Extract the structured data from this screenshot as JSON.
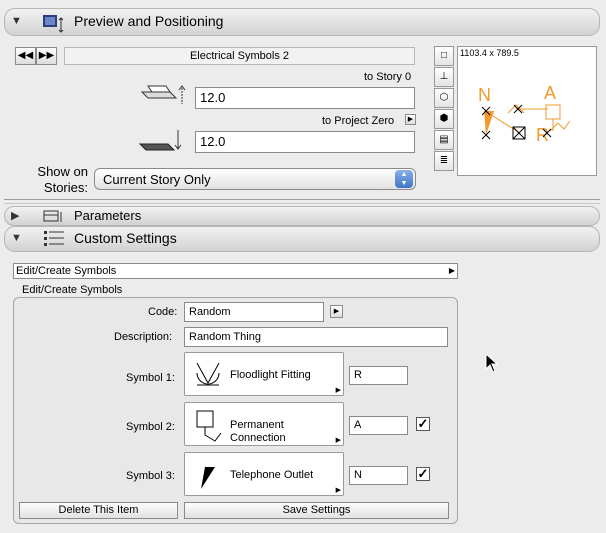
{
  "preview_section": {
    "title": "Preview and Positioning",
    "prev_label": "◀◀",
    "next_label": "▶▶",
    "symbol_name": "Electrical Symbols 2",
    "to_story_label": "to Story 0",
    "top_value": "12.0",
    "to_project_zero_label": "to Project Zero",
    "bottom_value": "12.0",
    "show_on_stories_label": "Show on\nStories:",
    "show_on_stories_value": "Current Story Only",
    "preview_size": "1103.4 x 789.5",
    "preview_letters": [
      "N",
      "A",
      "R"
    ]
  },
  "parameters_section": {
    "title": "Parameters"
  },
  "custom_section": {
    "title": "Custom Settings",
    "dropdown_value": "Edit/Create Symbols",
    "group_label": "Edit/Create Symbols",
    "code_label": "Code:",
    "code_value": "Random",
    "description_label": "Description:",
    "description_value": "Random Thing",
    "symbols": [
      {
        "label": "Symbol 1:",
        "name": "Floodlight Fitting",
        "letter": "R",
        "checked": false
      },
      {
        "label": "Symbol 2:",
        "name": "Permanent Connection",
        "letter": "A",
        "checked": true
      },
      {
        "label": "Symbol 3:",
        "name": "Telephone Outlet",
        "letter": "N",
        "checked": true
      }
    ],
    "delete_label": "Delete This Item",
    "save_label": "Save Settings"
  },
  "colors": {
    "accent_orange": "#f29a2e",
    "panel_bg": "#ececec"
  }
}
